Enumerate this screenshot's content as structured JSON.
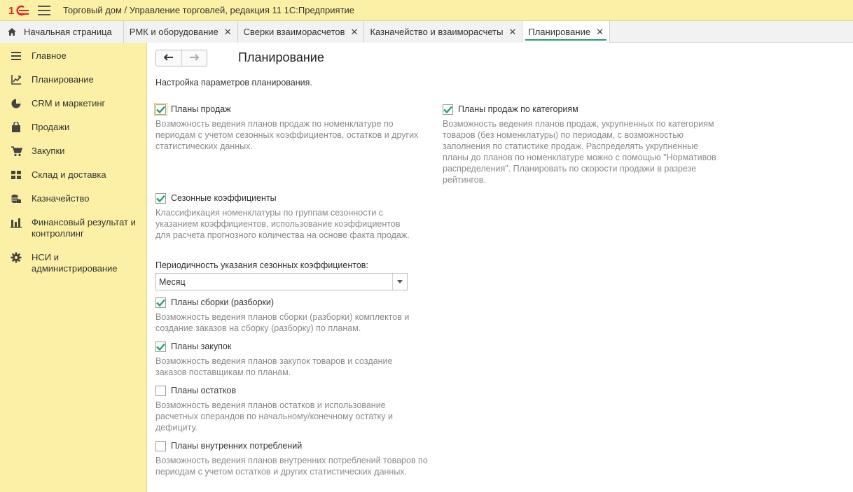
{
  "app": {
    "logo": "1С",
    "title": "Торговый дом / Управление торговлей, редакция 11 1С:Предприятие"
  },
  "tabs": [
    {
      "label": "Начальная страница",
      "icon": "home-icon"
    },
    {
      "label": "РМК и оборудование"
    },
    {
      "label": "Сверки взаиморасчетов"
    },
    {
      "label": "Казначейство и взаиморасчеты"
    },
    {
      "label": "Планирование",
      "active": true
    }
  ],
  "sidebar": {
    "items": [
      {
        "label": "Главное",
        "icon": "list-icon"
      },
      {
        "label": "Планирование",
        "icon": "planning-icon"
      },
      {
        "label": "CRM и маркетинг",
        "icon": "pie-icon"
      },
      {
        "label": "Продажи",
        "icon": "bag-icon"
      },
      {
        "label": "Закупки",
        "icon": "cart-icon"
      },
      {
        "label": "Склад и доставка",
        "icon": "warehouse-icon"
      },
      {
        "label": "Казначейство",
        "icon": "coins-icon"
      },
      {
        "label": "Финансовый результат и контроллинг",
        "icon": "bar-chart-icon"
      },
      {
        "label": "НСИ и администрирование",
        "icon": "gear-icon"
      }
    ]
  },
  "main": {
    "title": "Планирование",
    "subtitle": "Настройка параметров планирования.",
    "options": {
      "sales_plans": {
        "label": "Планы продаж",
        "checked": true,
        "desc": "Возможность ведения планов продаж по номенклатуре по периодам с учетом сезонных коэффициентов, остатков и других статистических данных."
      },
      "category_plans": {
        "label": "Планы продаж по категориям",
        "checked": true,
        "desc": "Возможность ведения планов продаж, укрупненных по категориям товаров (без номенклатуры) по периодам, с возможностью заполнения по статистике продаж. Распределять укрупненные планы до планов по номенклатуре можно с помощью \"Нормативов распределения\". Планировать по скорости продажи в разрезе рейтингов."
      },
      "seasonal": {
        "label": "Сезонные коэффициенты",
        "checked": true,
        "desc": "Классификация номенклатуры по группам сезонности с указанием коэффициентов, использование коэффициентов для расчета прогнозного количества на основе факта продаж."
      },
      "assembly": {
        "label": "Планы сборки (разборки)",
        "checked": true,
        "desc": "Возможность ведения планов сборки (разборки) комплектов и создание заказов на сборку (разборку) по планам."
      },
      "purchases": {
        "label": "Планы закупок",
        "checked": true,
        "desc": "Возможность ведения планов закупок товаров и создание заказов поставщикам по планам."
      },
      "stocks": {
        "label": "Планы остатков",
        "checked": false,
        "desc": "Возможность ведения планов остатков и использование расчетных операндов по начальному/конечному остатку и дефициту."
      },
      "internal": {
        "label": "Планы внутренних потреблений",
        "checked": false,
        "desc": "Возможность ведения планов внутренних потреблений товаров по периодам с учетом остатков и других статистических данных."
      }
    },
    "periodicity": {
      "label": "Периодичность указания сезонных коэффициентов:",
      "value": "Месяц"
    }
  },
  "colors": {
    "accent": "#26a06b",
    "logo_red": "#e32227",
    "panel": "#fbf0a5"
  }
}
